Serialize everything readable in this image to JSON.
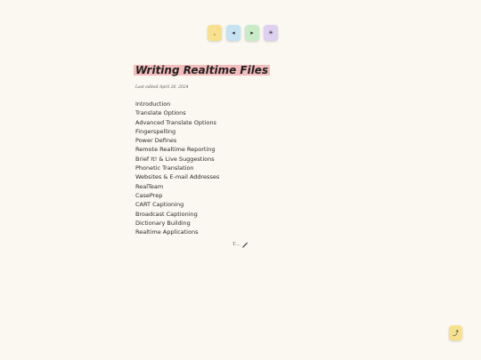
{
  "toolbar": {
    "buttons": [
      {
        "name": "comma-button",
        "glyph": ",",
        "color": "#f7e18e"
      },
      {
        "name": "previous-button",
        "glyph": "◂",
        "color": "#c5e3f2"
      },
      {
        "name": "next-button",
        "glyph": "▸",
        "color": "#c9ebc6"
      },
      {
        "name": "theme-button",
        "glyph": "☀",
        "color": "#ddd0f0"
      }
    ]
  },
  "page": {
    "title": "Writing Realtime Files",
    "last_edited": "Last edited April 26, 2024",
    "highlight_color": "#f4bcbc",
    "background_color": "#faf8f0"
  },
  "documents": [
    "Introduction",
    "Translate Options",
    "Advanced Translate Options",
    "Fingerspelling",
    "Power Defines",
    "Remote Realtime Reporting",
    "Brief It! & Live Suggestions",
    "Phonetic Translation",
    "Websites & E-mail Addresses",
    "RealTeam",
    "CasePrep",
    "CART Captioning",
    "Broadcast Captioning",
    "Dictionary Building",
    "Realtime Applications"
  ],
  "signature": {
    "text": "T....",
    "icon": "pen-icon"
  },
  "scroll_top": {
    "glyph": "⤴",
    "icon": "scroll-to-top-icon",
    "color": "#f7e18e"
  }
}
